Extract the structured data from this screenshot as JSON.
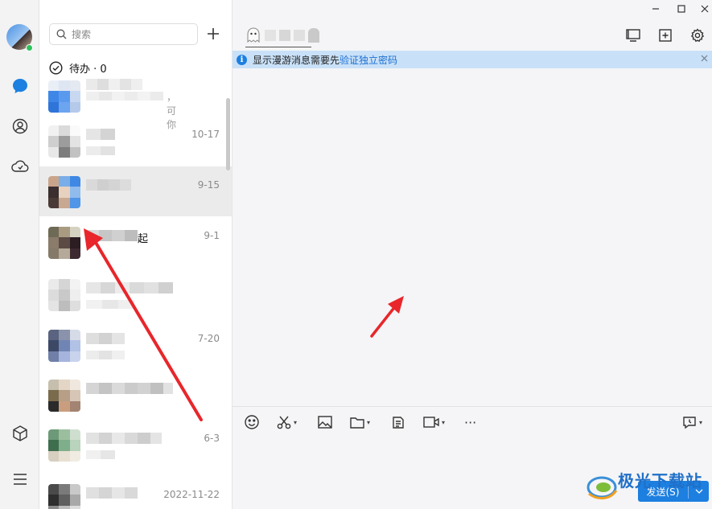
{
  "search": {
    "placeholder": "搜索"
  },
  "todo": {
    "label": "待办 · 0"
  },
  "contacts": [
    {
      "time": "",
      "name_suffix": "",
      "preview": "，可你"
    },
    {
      "time": "10-17",
      "name_suffix": "",
      "preview": ""
    },
    {
      "time": "9-15",
      "name_suffix": "",
      "preview": "",
      "selected": true
    },
    {
      "time": "9-1",
      "name_suffix": "起",
      "preview": ""
    },
    {
      "time": "",
      "name_suffix": "",
      "preview": ""
    },
    {
      "time": "7-20",
      "name_suffix": "",
      "preview": ""
    },
    {
      "time": "",
      "name_suffix": "",
      "preview": ""
    },
    {
      "time": "6-3",
      "name_suffix": "",
      "preview": ""
    },
    {
      "time": "2022-11-22",
      "name_suffix": "",
      "preview": ""
    }
  ],
  "notice": {
    "text": "显示漫游消息需要先",
    "link": "验证独立密码"
  },
  "send": {
    "label": "发送(S)"
  },
  "watermark": {
    "text": "极光下载站"
  },
  "colors": {
    "accent": "#1d7fe0",
    "arrow": "#e8262b"
  }
}
